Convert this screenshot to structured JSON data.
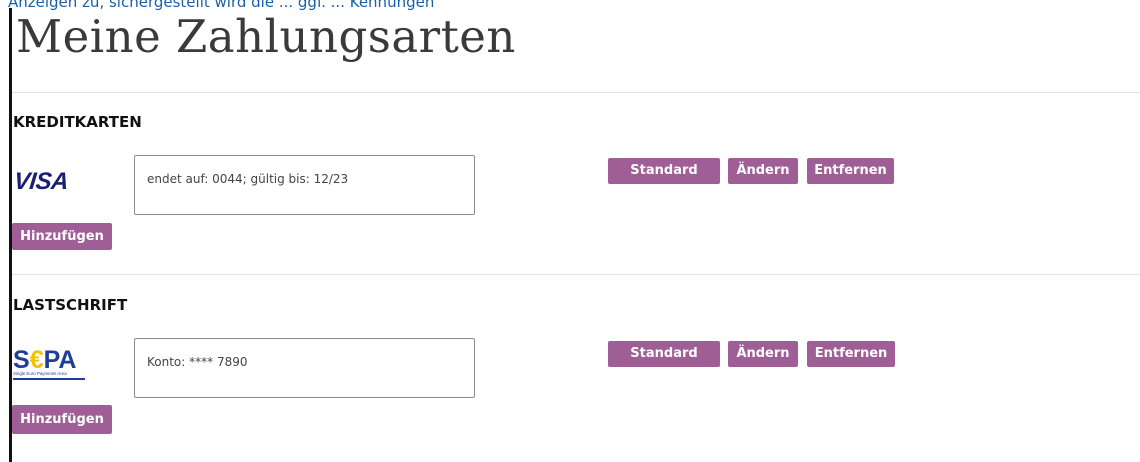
{
  "top_link": "Anzeigen zu, sichergestellt wird die ... ggf. ... Kennungen",
  "page_title": "Meine Zahlungsarten",
  "sections": {
    "credit": {
      "heading": "KREDITKARTEN",
      "logo": "VISA",
      "card_info": "endet auf: 0044; gültig bis: 12/23",
      "buttons": {
        "standard": "Standard",
        "edit": "Ändern",
        "remove": "Entfernen"
      },
      "add": "Hinzufügen"
    },
    "debit": {
      "heading": "LASTSCHRIFT",
      "logo_text": "S€PA",
      "logo_subtitle": "Single Euro Payments Area",
      "account_info": "Konto: **** 7890",
      "buttons": {
        "standard": "Standard",
        "edit": "Ändern",
        "remove": "Entfernen"
      },
      "add": "Hinzufügen"
    }
  },
  "colors": {
    "button": "#a05e97",
    "visa": "#1a1f71",
    "sepa_blue": "#1e3f95",
    "sepa_yellow": "#f2c100"
  },
  "icons": {
    "visa": "visa-logo-icon",
    "sepa": "sepa-logo-icon"
  }
}
